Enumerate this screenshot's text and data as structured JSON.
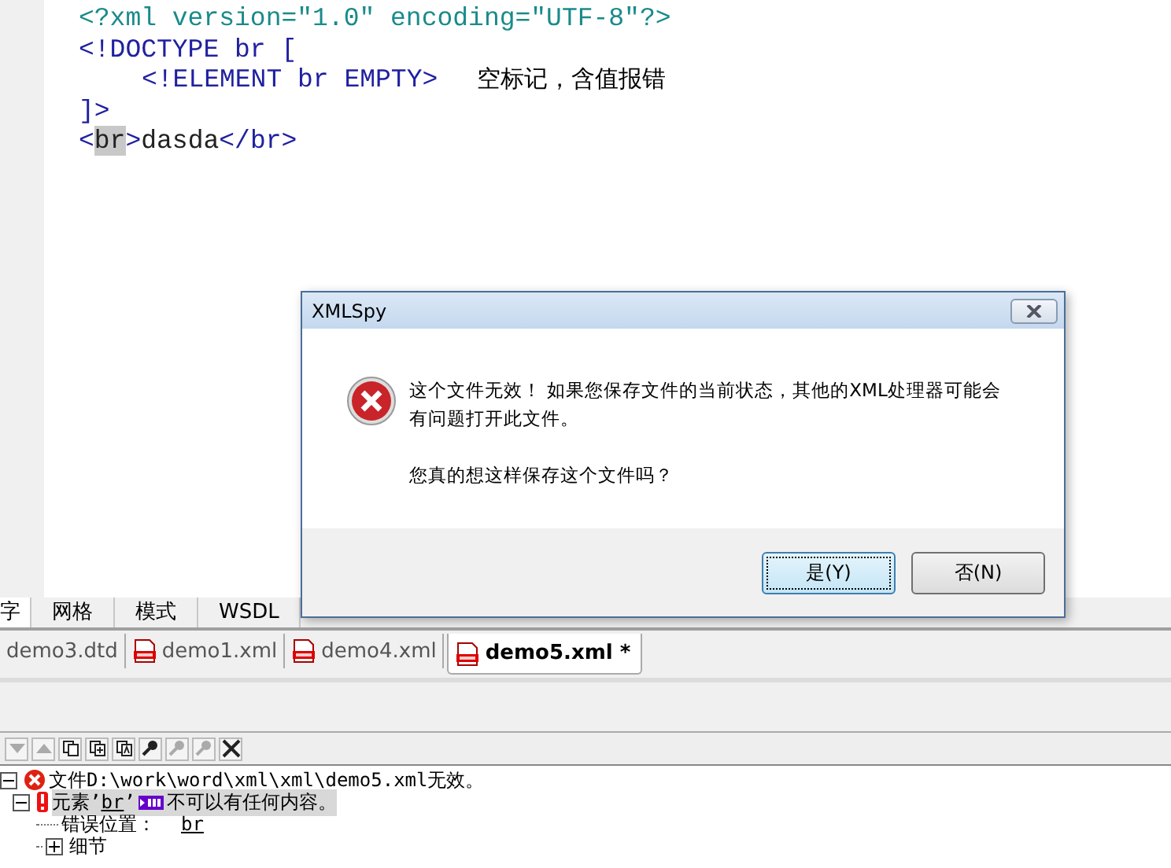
{
  "editor": {
    "lines": [
      {
        "indent": false,
        "segments": [
          {
            "kind": "pi",
            "text": "<?xml version=″1.0″ encoding=″UTF-8″?>"
          }
        ]
      },
      {
        "indent": false,
        "segments": [
          {
            "kind": "tag",
            "text": "<!DOCTYPE br ["
          }
        ]
      },
      {
        "indent": true,
        "segments": [
          {
            "kind": "tag",
            "text": "<!ELEMENT br EMPTY>"
          },
          {
            "kind": "note",
            "text": "空标记，含值报错"
          }
        ]
      },
      {
        "indent": false,
        "segments": [
          {
            "kind": "tag",
            "text": "]>"
          }
        ]
      },
      {
        "indent": false,
        "segments": [
          {
            "kind": "tag",
            "text": "<"
          },
          {
            "kind": "highlight",
            "text": "br"
          },
          {
            "kind": "tag",
            "text": ">"
          },
          {
            "kind": "text",
            "text": "dasda"
          },
          {
            "kind": "tag",
            "text": "</"
          },
          {
            "kind": "name",
            "text": "br"
          },
          {
            "kind": "tag",
            "text": ">"
          }
        ]
      }
    ]
  },
  "view_tabs": [
    {
      "label": "字",
      "selected": true
    },
    {
      "label": "网格",
      "selected": false
    },
    {
      "label": "模式",
      "selected": false
    },
    {
      "label": "WSDL",
      "selected": false
    }
  ],
  "file_tabs": [
    {
      "label": "demo3.dtd",
      "icon": false,
      "selected": false
    },
    {
      "label": "demo1.xml",
      "icon": true,
      "selected": false
    },
    {
      "label": "demo4.xml",
      "icon": true,
      "selected": false
    },
    {
      "label": "demo5.xml *",
      "icon": true,
      "selected": true
    }
  ],
  "toolbar": [
    {
      "kind": "down",
      "disabled": true
    },
    {
      "kind": "up",
      "disabled": true
    },
    {
      "kind": "copy",
      "disabled": false
    },
    {
      "kind": "copy-plus",
      "disabled": false
    },
    {
      "kind": "copy-text",
      "disabled": false
    },
    {
      "kind": "find",
      "disabled": false
    },
    {
      "kind": "find-prev",
      "disabled": true
    },
    {
      "kind": "find-next",
      "disabled": true
    },
    {
      "kind": "clear",
      "disabled": false
    }
  ],
  "messages": [
    {
      "expanded": true,
      "selected": false,
      "text": "文件D:\\work\\word\\xml\\xml\\demo5.xml无效。",
      "children": [
        {
          "expanded": true,
          "selected": true,
          "text": "元素’",
          "link": "br",
          "text_after": "’",
          "def": true,
          "text_tail": "不可以有任何内容。",
          "children": [
            {
              "text": "错误位置：",
              "link": "br"
            },
            {
              "expanded": false,
              "text": "细节"
            }
          ]
        }
      ]
    }
  ],
  "dialog": {
    "title": "XMLSpy",
    "message": "这个文件无效！ 如果您保存文件的当前状态，其他的XML处理器可能会有问题打开此文件。",
    "question": "您真的想这样保存这个文件吗？",
    "buttons": [
      {
        "label": "是(Y)",
        "default": true
      },
      {
        "label": "否(N)",
        "default": false
      }
    ]
  }
}
